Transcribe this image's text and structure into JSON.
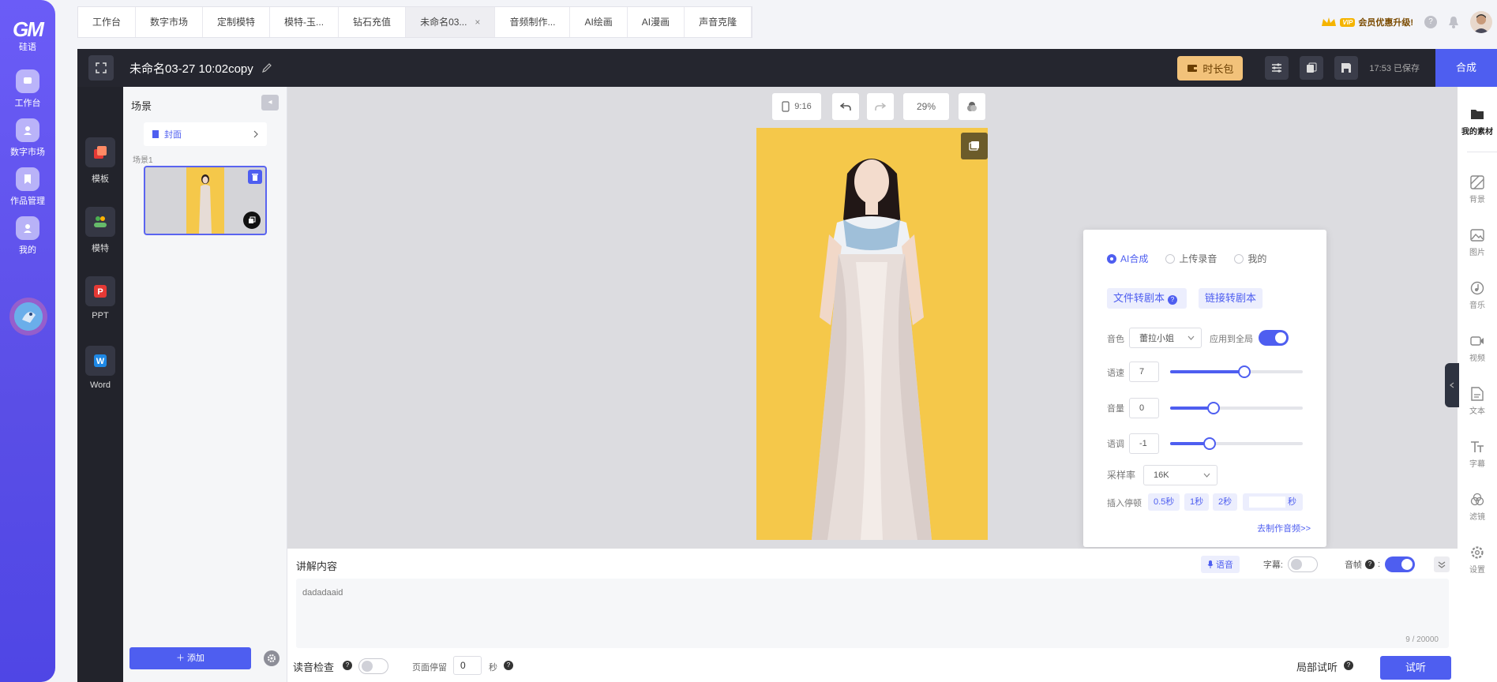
{
  "rail": {
    "logo_text": "GM",
    "logo_sub": "硅语",
    "items": [
      {
        "label": "工作台"
      },
      {
        "label": "数字市场"
      },
      {
        "label": "作品管理"
      },
      {
        "label": "我的"
      }
    ]
  },
  "tabs": [
    {
      "label": "工作台"
    },
    {
      "label": "数字市场"
    },
    {
      "label": "定制模特"
    },
    {
      "label": "模特-玉..."
    },
    {
      "label": "钻石充值"
    },
    {
      "label": "未命名03...",
      "active": true,
      "close": "×"
    },
    {
      "label": "音频制作..."
    },
    {
      "label": "AI绘画"
    },
    {
      "label": "AI漫画"
    },
    {
      "label": "声音克隆"
    }
  ],
  "topright": {
    "vip_tag": "VIP",
    "vip_text": "会员优惠升级!",
    "help": "?"
  },
  "editor": {
    "title": "未命名03-27 10:02copy",
    "duration_pack": "时长包",
    "save_status": "17:53 已保存",
    "compose": "合成"
  },
  "side_panel": [
    {
      "label": "模板"
    },
    {
      "label": "模特"
    },
    {
      "label": "PPT",
      "glyph": "P"
    },
    {
      "label": "Word",
      "glyph": "W"
    }
  ],
  "scenes": {
    "title": "场景",
    "collapse": "◂",
    "cover": "封面",
    "scene_label": "场景1",
    "add": "＋ 添加"
  },
  "canvas_toolbar": {
    "ratio": "9:16",
    "zoom": "29%"
  },
  "voice_panel": {
    "modes": [
      {
        "label": "AI合成",
        "selected": true
      },
      {
        "label": "上传录音",
        "selected": false
      },
      {
        "label": "我的",
        "selected": false
      }
    ],
    "file_to_script": "文件转剧本",
    "link_to_script": "链接转剧本",
    "help": "?",
    "timbre_label": "音色",
    "timbre_value": "蕾拉小姐",
    "apply_all_label": "应用到全局",
    "apply_all": true,
    "speed_label": "语速",
    "speed_value": "7",
    "speed_level": 0.56,
    "volume_label": "音量",
    "volume_value": "0",
    "volume_level": 0.33,
    "pitch_label": "语调",
    "pitch_value": "-1",
    "pitch_level": 0.3,
    "sample_rate_label": "采样率",
    "sample_rate_value": "16K",
    "pause_label": "插入停顿",
    "pauses": [
      "0.5秒",
      "1秒",
      "2秒"
    ],
    "pause_unit": "秒",
    "make_audio_link": "去制作音频>>"
  },
  "right_rail": [
    {
      "label": "我的素材",
      "active": true
    },
    {
      "label": "背景"
    },
    {
      "label": "图片"
    },
    {
      "label": "音乐"
    },
    {
      "label": "视频"
    },
    {
      "label": "文本"
    },
    {
      "label": "字幕"
    },
    {
      "label": "滤镜"
    },
    {
      "label": "设置"
    }
  ],
  "narration": {
    "title": "讲解内容",
    "voice_chip": "语音",
    "subtitle_label": "字幕:",
    "subtitle_on": false,
    "keyframe_label": "音帧",
    "keyframe_on": true,
    "text": "dadadaaid",
    "count": "9 / 20000",
    "pronunciation_check": "读音检查",
    "page_stay_label": "页面停留",
    "page_stay_value": "0",
    "seconds": "秒",
    "partial_listen": "局部试听",
    "listen": "试听"
  },
  "colors": {
    "accent": "#4e5ef0",
    "rail": "#5a4ee6",
    "editor_header": "#25262f",
    "stage_bg": "#f5c84a"
  }
}
